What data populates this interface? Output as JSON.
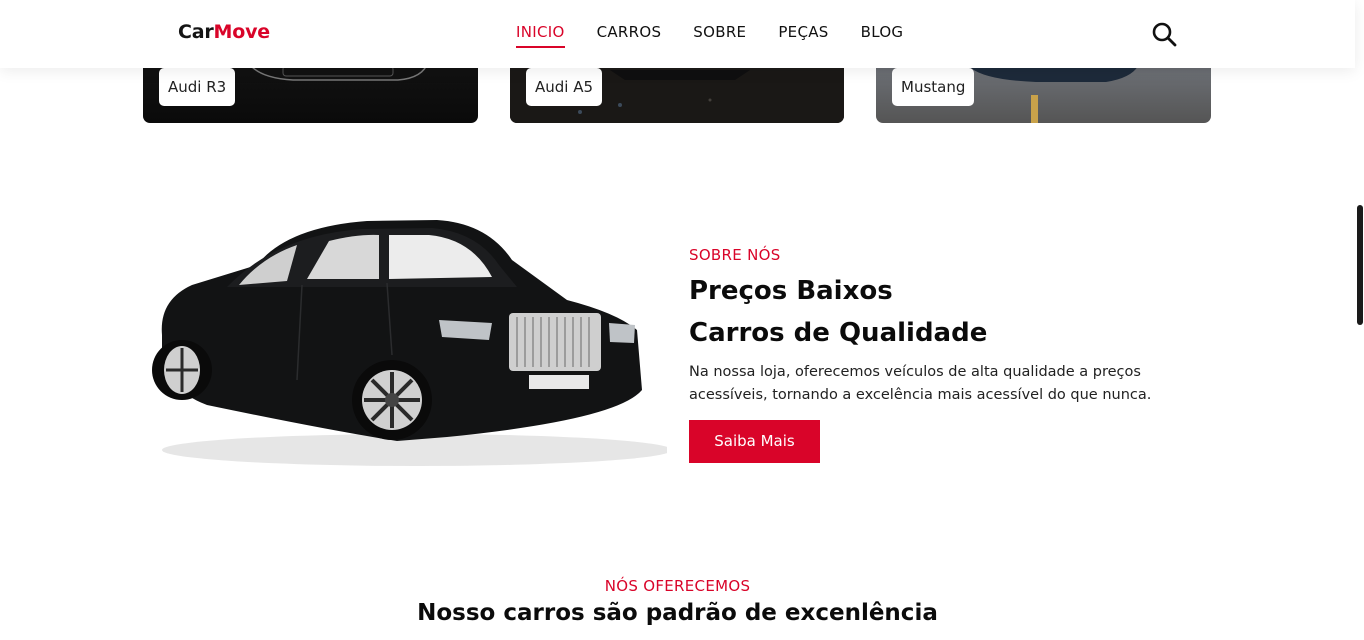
{
  "header": {
    "logo_part1": "Car",
    "logo_part2": "Move",
    "nav": [
      "INICIO",
      "CARROS",
      "SOBRE",
      "PEÇAS",
      "BLOG"
    ],
    "active_nav": "INICIO",
    "search_icon": "search-icon"
  },
  "cards": [
    {
      "label": "Audi R3"
    },
    {
      "label": "Audi A5"
    },
    {
      "label": "Mustang"
    }
  ],
  "about": {
    "eyebrow": "SOBRE NÓS",
    "title_line1": "Preços Baixos",
    "title_line2": "Carros de Qualidade",
    "text": "Na nossa loja, oferecemos veículos de alta qualidade a preços acessíveis, tornando a excelência mais acessível do que nunca.",
    "button": "Saiba Mais"
  },
  "offer": {
    "eyebrow": "NÓS OFERECEMOS",
    "title": "Nosso carros são padrão de excenlência"
  },
  "colors": {
    "accent": "#d90429",
    "text": "#111111"
  }
}
